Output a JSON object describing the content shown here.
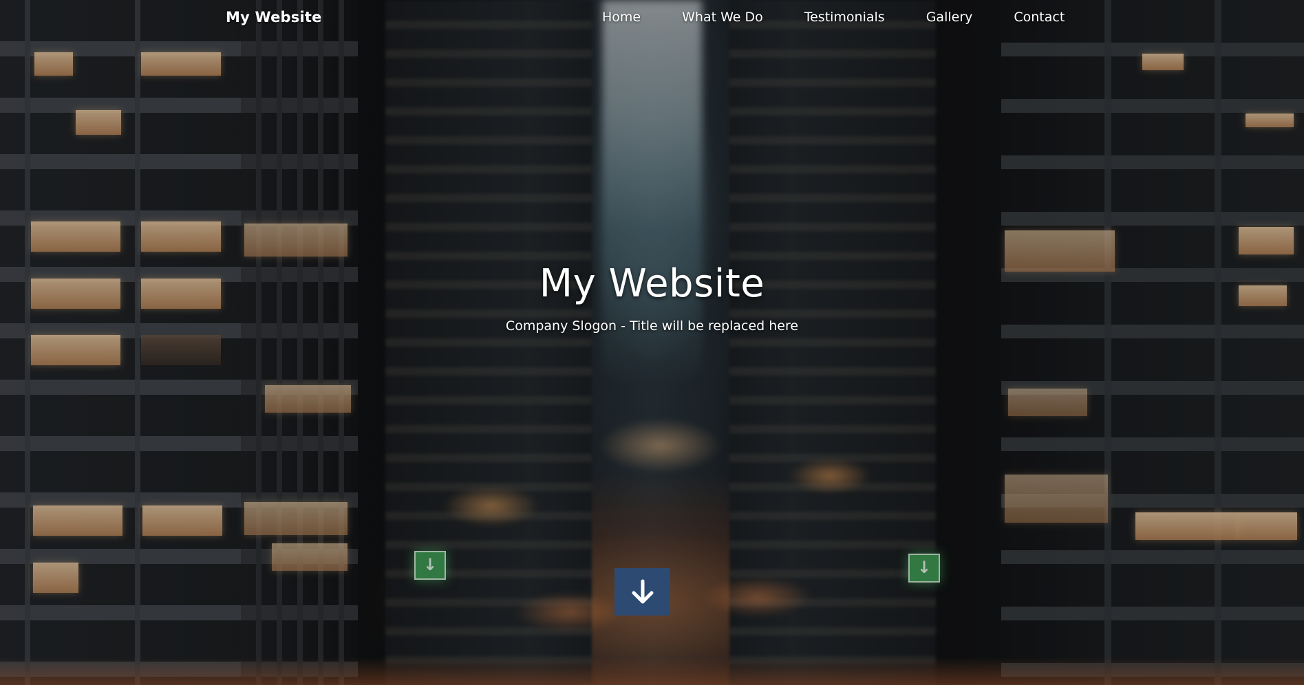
{
  "navbar": {
    "brand": "My Website",
    "links": [
      {
        "label": "Home"
      },
      {
        "label": "What We Do"
      },
      {
        "label": "Testimonials"
      },
      {
        "label": "Gallery"
      },
      {
        "label": "Contact"
      }
    ]
  },
  "hero": {
    "title": "My Website",
    "subtitle": "Company Slogon - Title will be replaced here",
    "scroll_button_icon": "arrow-down-icon"
  },
  "colors": {
    "scroll_button": "#2d4a73",
    "text": "#ffffff"
  }
}
